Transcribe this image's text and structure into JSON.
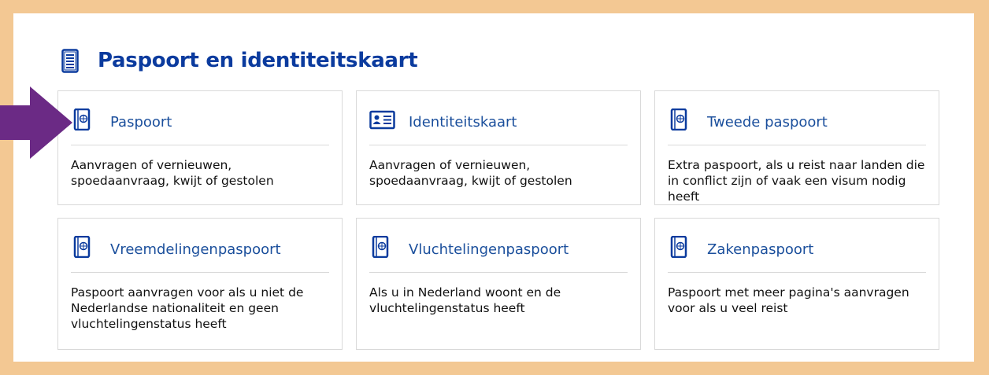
{
  "page": {
    "title": "Paspoort en identiteitskaart",
    "accent_color": "#0b3b9e",
    "frame_color": "#f3c893",
    "arrow_color": "#6b2a85"
  },
  "cards": [
    {
      "title": "Paspoort",
      "description": "Aanvragen of vernieuwen, spoedaanvraag, kwijt of gestolen",
      "icon": "passport-icon"
    },
    {
      "title": "Identiteitskaart",
      "description": "Aanvragen of vernieuwen, spoedaanvraag, kwijt of gestolen",
      "icon": "id-card-icon"
    },
    {
      "title": "Tweede paspoort",
      "description": "Extra paspoort, als u reist naar landen die in conflict zijn of vaak een visum nodig heeft",
      "icon": "passport-icon"
    },
    {
      "title": "Vreemdelingenpaspoort",
      "description": "Paspoort aanvragen voor als u niet de Nederlandse nationaliteit en geen vluchtelingenstatus heeft",
      "icon": "passport-icon"
    },
    {
      "title": "Vluchtelingenpaspoort",
      "description": "Als u in Nederland woont en de vluchtelingenstatus heeft",
      "icon": "passport-icon"
    },
    {
      "title": "Zakenpaspoort",
      "description": "Paspoort met meer pagina's aanvragen voor als u veel reist",
      "icon": "passport-icon"
    }
  ]
}
